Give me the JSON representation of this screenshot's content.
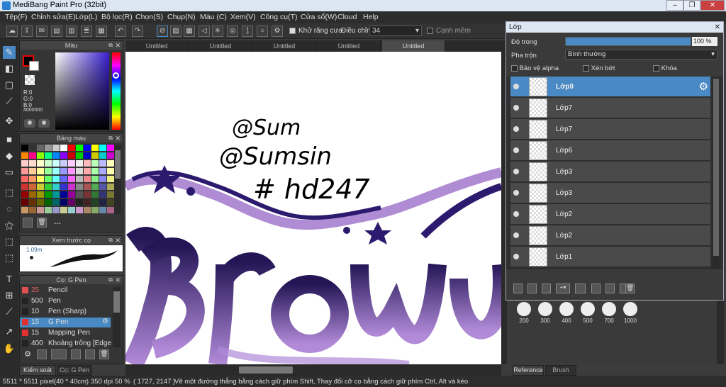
{
  "window": {
    "title": "MediBang Paint Pro (32bit)"
  },
  "menu": [
    "Tệp(F)",
    "Chỉnh sửa(E)",
    "Lớp(L)",
    "Bộ lọc(R)",
    "Chọn(S)",
    "Chụp(N)",
    "Màu (C)",
    "Xem(V)",
    "Công cụ(T)",
    "Cửa sổ(W)",
    "Cloud",
    "Help"
  ],
  "toolbar": {
    "antialias": "Khử răng cưa",
    "correction_label": "Điều chỉnh",
    "correction_value": "34",
    "snap": "Cạnh mềm"
  },
  "tabs": [
    "Untitled",
    "Untitled",
    "Untitled",
    "Untitled",
    "Untitled"
  ],
  "color_panel": {
    "title": "Màu",
    "r": "R:0",
    "g": "G:0",
    "b": "B:0",
    "hex": "#000000"
  },
  "palette_panel": {
    "title": "Bảng màu",
    "footer": "---"
  },
  "preview_panel": {
    "title": "Xem trước cọ",
    "size": "1.09m"
  },
  "brush_panel": {
    "title": "Cọ: G Pen",
    "items": [
      {
        "size": "25",
        "name": "Pencil",
        "color": "#e05050"
      },
      {
        "size": "500",
        "name": "Pen",
        "color": "#222"
      },
      {
        "size": "10",
        "name": "Pen (Sharp)",
        "color": "#222"
      },
      {
        "size": "15",
        "name": "G Pen",
        "color": "#e03030"
      },
      {
        "size": "15",
        "name": "Mapping Pen",
        "color": "#e03030"
      },
      {
        "size": "400",
        "name": "Khoảng trống [Edge I",
        "color": "#222"
      }
    ]
  },
  "bottom_tabs": [
    "Kiểm soát cọ",
    "Cọ: G Pen"
  ],
  "status": {
    "size": "5511 * 5511 pixel",
    "cm": "(40 * 40cm)",
    "dpi": "350 dpi",
    "zoom": "50 %",
    "coords": "( 1727, 2147 )",
    "hint": "Vẽ một đường thẳng bằng cách giữ phím Shift, Thay đổi cỡ cọ bằng cách giữ phím Ctrl, Alt và kéo"
  },
  "layer_panel": {
    "title": "Lớp",
    "opacity_label": "Độ trong",
    "opacity_value": "100 %",
    "opacity": 1.0,
    "blend_label": "Pha trộn",
    "blend_value": "Bình thường",
    "protect_alpha": "Bảo vệ alpha",
    "clip": "Xén bớt",
    "lock": "Khóa",
    "layers": [
      "Lớp9",
      "Lớp7",
      "Lớp7",
      "Lớp6",
      "Lớp3",
      "Lớp3",
      "Lớp2",
      "Lớp2",
      "Lớp1"
    ]
  },
  "brush_sizes": [
    "200",
    "300",
    "400",
    "500",
    "700",
    "1000"
  ],
  "right_tabs": [
    "Reference",
    "Brush Size"
  ],
  "canvas_text": {
    "line1": "@Sum",
    "line2": "@Sumsin",
    "line3": "# hd247",
    "art": "Brow"
  },
  "colors": {
    "accent": "#4a8ac4",
    "purple": "#2c1a6e",
    "lilac": "#9b6fc8"
  }
}
